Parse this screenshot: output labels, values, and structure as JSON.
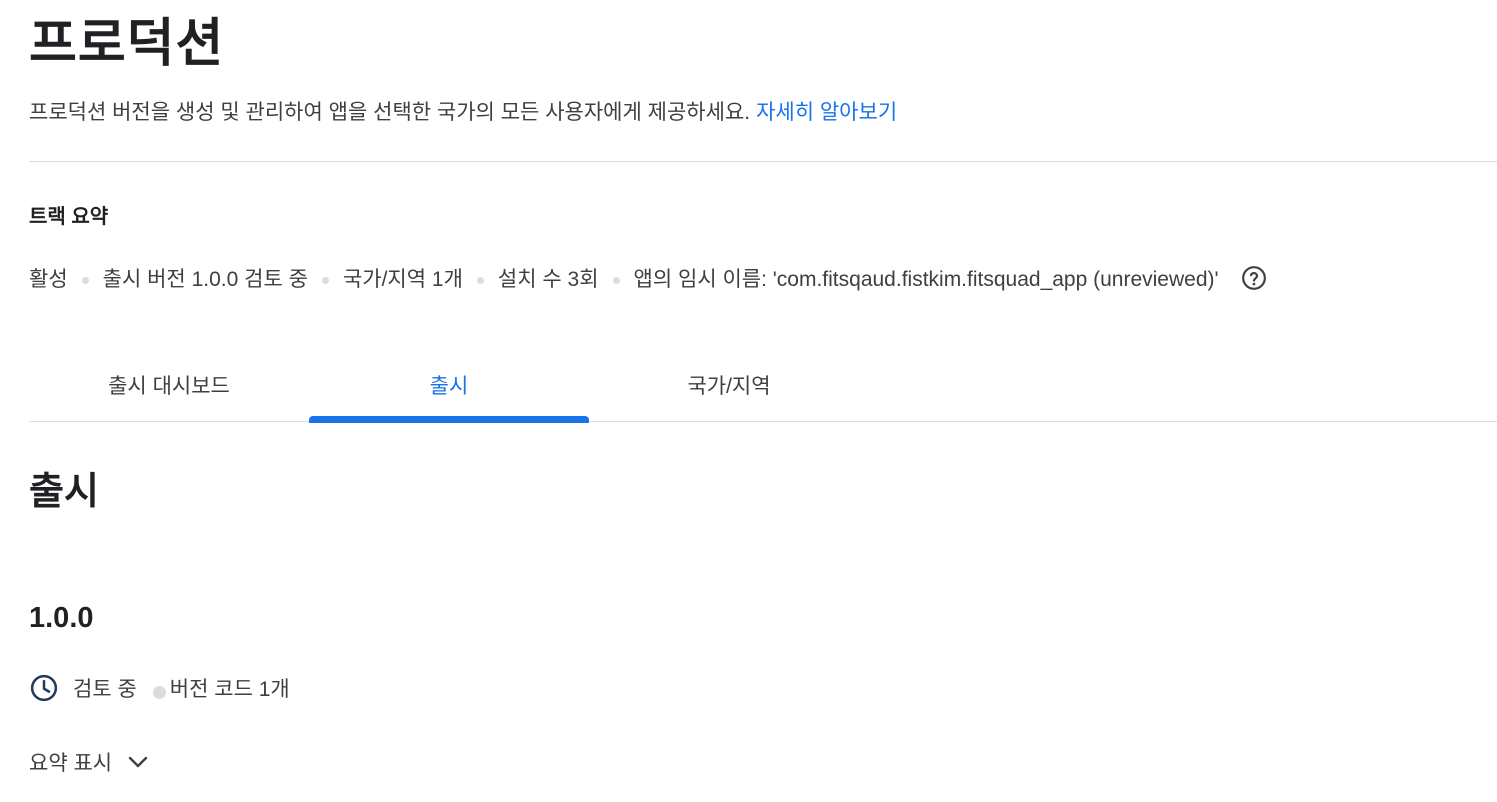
{
  "page": {
    "title": "프로덕션",
    "description": "프로덕션 버전을 생성 및 관리하여 앱을 선택한 국가의 모든 사용자에게 제공하세요.",
    "learn_more": "자세히 알아보기"
  },
  "track_summary": {
    "label": "트랙 요약",
    "items": [
      "활성",
      "출시 버전 1.0.0 검토 중",
      "국가/지역 1개",
      "설치 수 3회",
      "앱의 임시 이름: 'com.fitsqaud.fistkim.fitsquad_app (unreviewed)'"
    ],
    "help_icon": "help-circle-icon"
  },
  "tabs": [
    {
      "label": "출시 대시보드",
      "active": false
    },
    {
      "label": "출시",
      "active": true
    },
    {
      "label": "국가/지역",
      "active": false
    }
  ],
  "colors": {
    "accent": "#1a73e8",
    "divider": "#dadce0",
    "text": "#202124",
    "secondary_text": "#3c4043",
    "clock_icon": "#1f3c5a"
  },
  "releases": {
    "heading": "출시",
    "version": "1.0.0",
    "status_icon": "clock-icon",
    "status": "검토 중",
    "version_codes": "버전 코드 1개",
    "toggle_label": "요약 표시",
    "toggle_icon": "chevron-down-icon"
  }
}
